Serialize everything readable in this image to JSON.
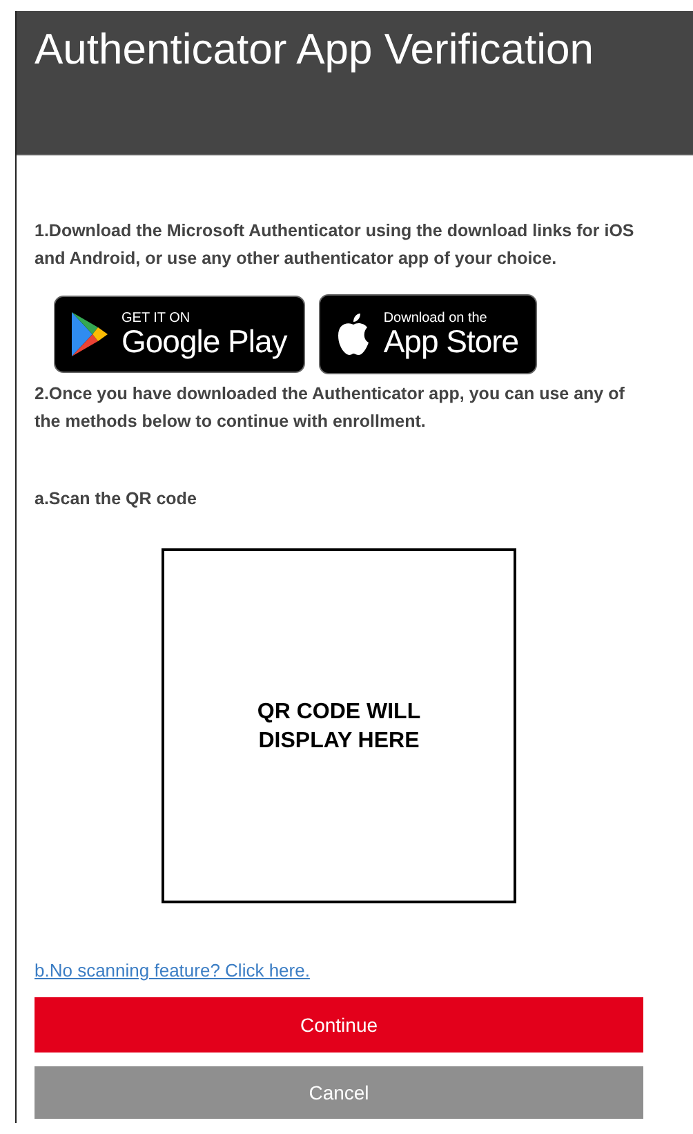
{
  "header": {
    "title": "Authenticator App Verification"
  },
  "steps": [
    {
      "text": "1.Download the Microsoft Authenticator using the download links for iOS and Android, or use any other authenticator app of your choice."
    }
  ],
  "store_badges": [
    {
      "kind": "google-play",
      "caption": "GET IT ON",
      "name": "Google Play"
    },
    {
      "kind": "app-store",
      "caption": "Download on the",
      "name": "App Store"
    }
  ],
  "step_2": "2.Once you have downloaded the Authenticator app, you can use any of the methods below to continue with enrollment.",
  "scan_label": "a.Scan the QR code",
  "qr_placeholder": "QR CODE WILL DISPLAY HERE",
  "manual_link": "b.No scanning feature? Click here.",
  "buttons": [
    {
      "label": "Continue",
      "disabled": false
    },
    {
      "label": "Cancel",
      "disabled": true
    }
  ]
}
